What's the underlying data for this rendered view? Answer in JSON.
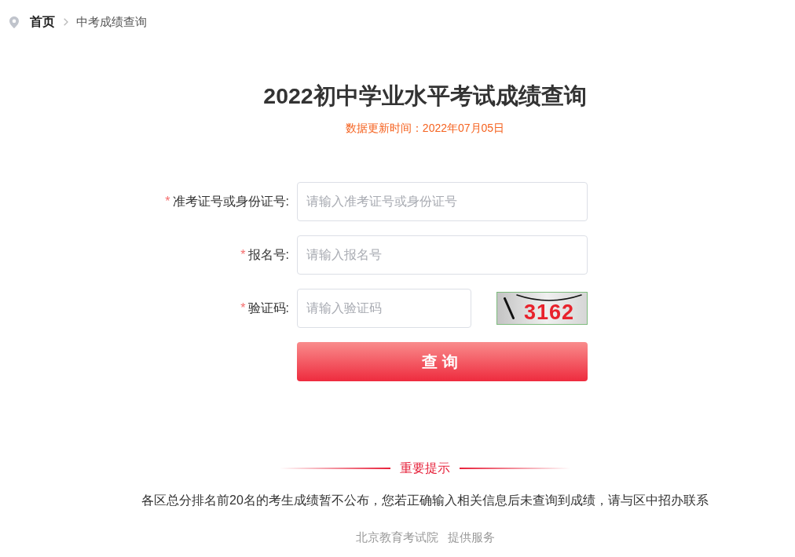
{
  "breadcrumb": [
    {
      "label": "首页",
      "current": false
    },
    {
      "label": "中考成绩查询",
      "current": true
    }
  ],
  "title": "2022初中学业水平考试成绩查询",
  "updated": "数据更新时间：2022年07月05日",
  "form": {
    "fields": [
      {
        "kind": "text",
        "required_mark": "*",
        "label": "准考证号或身份证号:",
        "placeholder": "请输入准考证号或身份证号"
      },
      {
        "kind": "text",
        "required_mark": "*",
        "label": "报名号:",
        "placeholder": "请输入报名号"
      },
      {
        "kind": "captcha",
        "required_mark": "*",
        "label": "验证码:",
        "placeholder": "请输入验证码",
        "captcha_code": "3162"
      }
    ],
    "submit": "查询"
  },
  "notice": {
    "heading": "重要提示",
    "text": "各区总分排名前20名的考生成绩暂不公布，您若正确输入相关信息后未查询到成绩，请与区中招办联系"
  },
  "footer": {
    "organization": "北京教育考试院",
    "service": "提供服务"
  }
}
